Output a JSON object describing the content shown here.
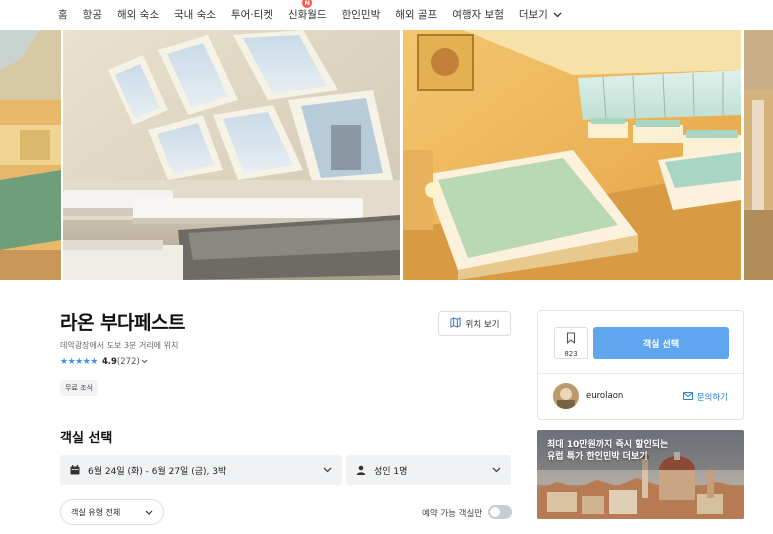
{
  "nav": {
    "items": [
      {
        "label": "홈"
      },
      {
        "label": "항공"
      },
      {
        "label": "해외 숙소"
      },
      {
        "label": "국내 숙소"
      },
      {
        "label": "투어·티켓"
      },
      {
        "label": "신화월드",
        "badge": "N"
      },
      {
        "label": "한인민박"
      },
      {
        "label": "해외 골프"
      },
      {
        "label": "여행자 보험"
      },
      {
        "label": "더보기"
      }
    ]
  },
  "listing": {
    "title": "라온 부다페스트",
    "location": "데악광장에서 도보 3분 거리에 위치",
    "rating_score": "4.9",
    "rating_count": "(272)",
    "tag": "무료 조식",
    "map_button": "위치 보기"
  },
  "booking": {
    "section_title": "객실 선택",
    "dates": "6월 24일 (화) - 6월 27일 (금), 3박",
    "guests": "성인 1명",
    "room_type": "객실 유형 전체",
    "available_only": "예약 가능 객실만"
  },
  "card": {
    "wish_count": "823",
    "select_button": "객실 선택",
    "host_name": "eurolaon",
    "contact": "문의하기"
  },
  "promo": {
    "line1": "최대 10만원까지 즉시 할인되는",
    "line2": "유럽 특가 한인민박 더보기"
  },
  "colors": {
    "accent": "#5fa6ee",
    "star": "#3d92f5",
    "link": "#2c7fe0",
    "new_badge": "#ff5a4e"
  },
  "icons": [
    "map-icon",
    "calendar-icon",
    "person-icon",
    "bookmark-icon",
    "mail-icon",
    "chevron-down-icon"
  ]
}
